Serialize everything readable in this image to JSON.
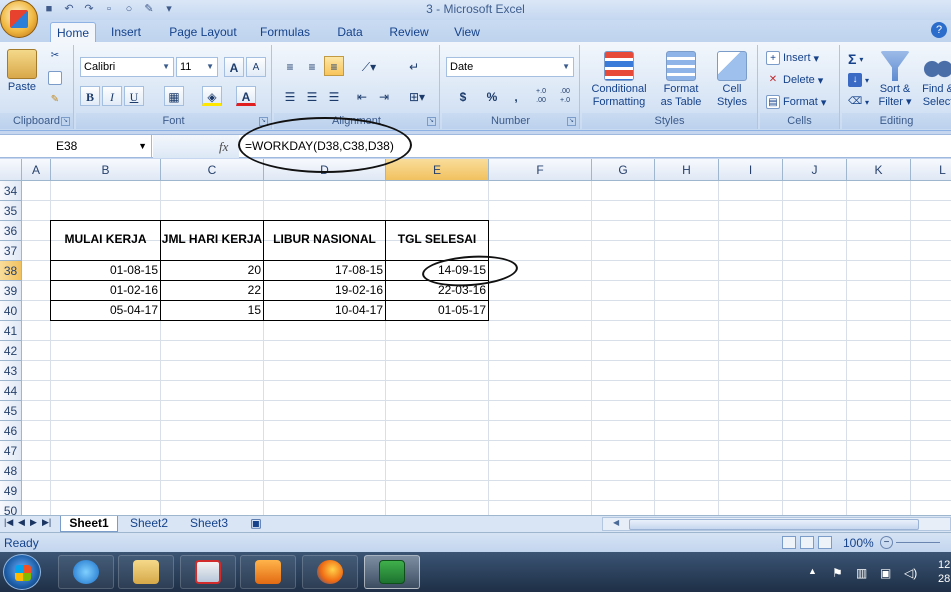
{
  "window": {
    "title": "3 - Microsoft Excel"
  },
  "tabs": [
    "Home",
    "Insert",
    "Page Layout",
    "Formulas",
    "Data",
    "Review",
    "View"
  ],
  "ribbon": {
    "clipboard": {
      "label": "Clipboard",
      "paste": "Paste"
    },
    "font": {
      "label": "Font",
      "name": "Calibri",
      "size": "11",
      "bold": "B",
      "italic": "I",
      "underline": "U",
      "grow": "A",
      "shrink": "A",
      "font_color": "A"
    },
    "alignment": {
      "label": "Alignment"
    },
    "number": {
      "label": "Number",
      "format": "Date",
      "currency": "$",
      "percent": "%",
      "comma": ",",
      "inc_decimal": "+.0 .00",
      "dec_decimal": ".00 +.0"
    },
    "styles": {
      "label": "Styles",
      "conditional_1": "Conditional",
      "conditional_2": "Formatting",
      "format_table_1": "Format",
      "format_table_2": "as Table",
      "cell_styles_1": "Cell",
      "cell_styles_2": "Styles"
    },
    "cells": {
      "label": "Cells",
      "insert": "Insert",
      "delete": "Delete",
      "format": "Format"
    },
    "editing": {
      "label": "Editing",
      "sigma": "Σ",
      "sort_1": "Sort &",
      "sort_2": "Filter",
      "find_1": "Find &",
      "find_2": "Select"
    }
  },
  "formula_bar": {
    "name_box": "E38",
    "fx": "fx",
    "formula": "=WORKDAY(D38,C38,D38)"
  },
  "columns": [
    "A",
    "B",
    "C",
    "D",
    "E",
    "F",
    "G",
    "H",
    "I",
    "J",
    "K",
    "L"
  ],
  "rows": [
    "34",
    "35",
    "36",
    "37",
    "38",
    "39",
    "40",
    "41",
    "42",
    "43",
    "44",
    "45",
    "46",
    "47",
    "48",
    "49",
    "50"
  ],
  "table": {
    "headers": [
      "MULAI  KERJA",
      "JML HARI KERJA",
      "LIBUR NASIONAL",
      "TGL SELESAI"
    ],
    "rows": [
      [
        "01-08-15",
        "20",
        "17-08-15",
        "14-09-15"
      ],
      [
        "01-02-16",
        "22",
        "19-02-16",
        "22-03-16"
      ],
      [
        "05-04-17",
        "15",
        "10-04-17",
        "01-05-17"
      ]
    ]
  },
  "sheets": [
    "Sheet1",
    "Sheet2",
    "Sheet3"
  ],
  "status": {
    "text": "Ready",
    "zoom": "100%"
  },
  "clock": {
    "line1": "12",
    "line2": "28"
  },
  "colors": {
    "ribbon_accent": "#15428b",
    "active_tab": "#f3f7fc",
    "annotation": "#111111"
  }
}
